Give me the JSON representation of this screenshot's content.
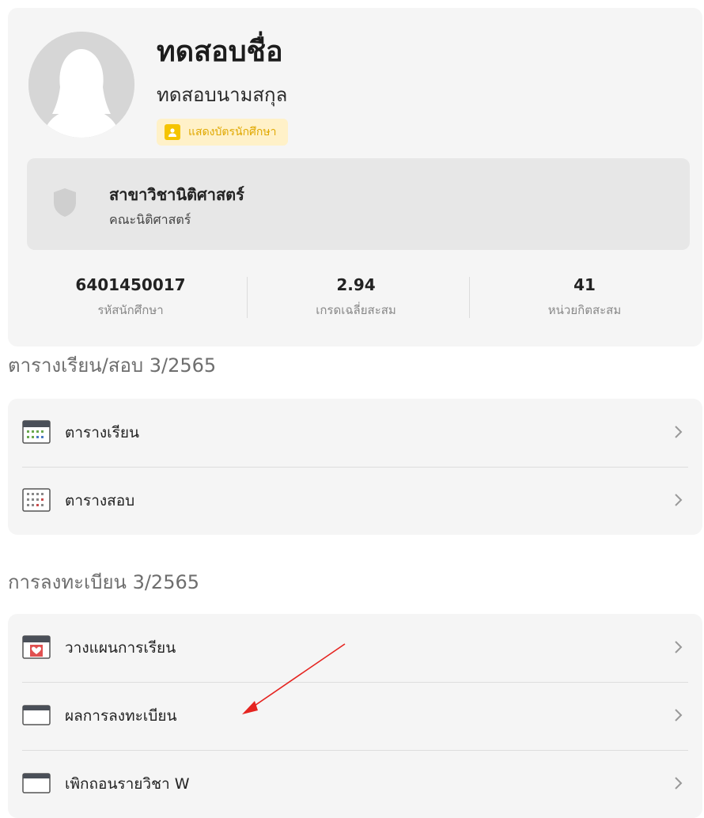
{
  "profile": {
    "first_name": "ทดสอบชื่อ",
    "last_name": "ทดสอบนามสกุล",
    "student_card_label": "แสดงบัตรนักศึกษา",
    "major": "สาขาวิชานิติศาสตร์",
    "faculty": "คณะนิติศาสตร์",
    "stats": [
      {
        "value": "6401450017",
        "label": "รหัสนักศึกษา"
      },
      {
        "value": "2.94",
        "label": "เกรดเฉลี่ยสะสม"
      },
      {
        "value": "41",
        "label": "หน่วยกิตสะสม"
      }
    ]
  },
  "schedule_section": {
    "title": "ตารางเรียน/สอบ 3/2565",
    "items": [
      {
        "label": "ตารางเรียน",
        "icon": "class-calendar-icon"
      },
      {
        "label": "ตารางสอบ",
        "icon": "exam-calendar-icon"
      }
    ]
  },
  "registration_section": {
    "title": "การลงทะเบียน 3/2565",
    "items": [
      {
        "label": "วางแผนการเรียน",
        "icon": "plan-calendar-icon"
      },
      {
        "label": "ผลการลงทะเบียน",
        "icon": "window-icon"
      },
      {
        "label": "เพิกถอนรายวิชา W",
        "icon": "window-icon"
      }
    ]
  },
  "colors": {
    "card_bg": "#f5f5f5",
    "badge_bg": "#fff1c8",
    "badge_accent": "#f5c400",
    "annotation_arrow": "#e52420"
  }
}
